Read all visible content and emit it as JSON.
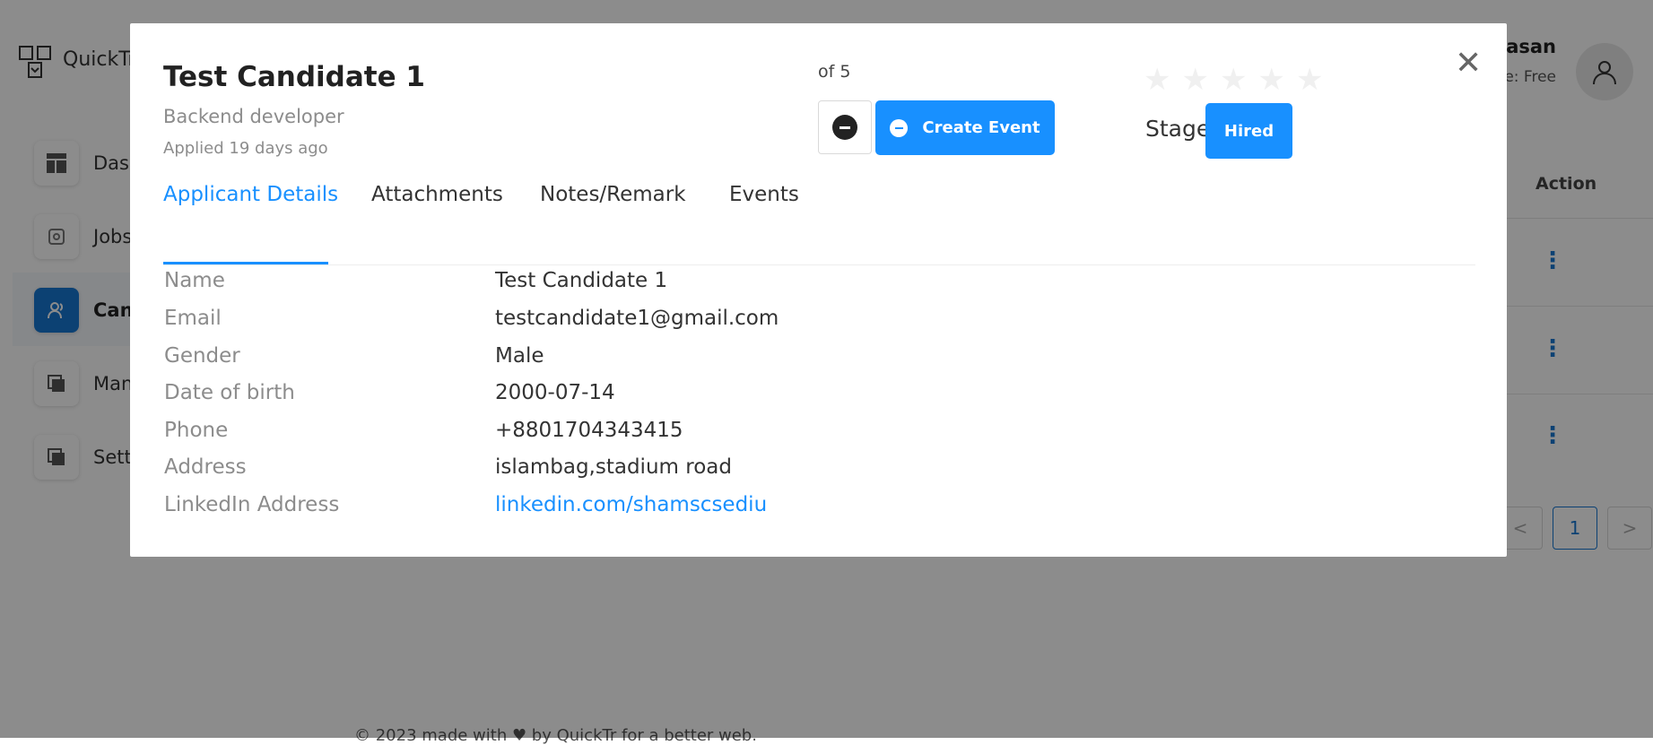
{
  "app": {
    "name": "QuickTr",
    "user_name": "Hasan",
    "user_plan": "e: Free"
  },
  "sidebar": {
    "items": [
      {
        "label": "Dash",
        "icon": "dashboard-icon"
      },
      {
        "label": "Jobs",
        "icon": "jobs-icon"
      },
      {
        "label": "Cand",
        "icon": "candidates-icon"
      },
      {
        "label": "Man",
        "icon": "copy-icon"
      },
      {
        "label": "Setti",
        "icon": "copy-icon"
      }
    ]
  },
  "table": {
    "action_header": "Action",
    "row_actions": [
      "⋮",
      "⋮",
      "⋮"
    ]
  },
  "pagination": {
    "prev": "<",
    "current": "1",
    "next": ">"
  },
  "footer": {
    "text": "© 2023 made with ♥ by QuickTr for a better web."
  },
  "modal": {
    "title": "Test Candidate 1",
    "role": "Backend developer",
    "applied": "Applied 19 days ago",
    "counter": "of 5",
    "create_event_label": "Create Event",
    "rating": 0,
    "rating_max": 5,
    "stage_label": "Stage",
    "stage_value": "Hired",
    "close_icon": "close-icon",
    "tabs": [
      {
        "label": "Applicant Details",
        "active": true
      },
      {
        "label": "Attachments",
        "active": false
      },
      {
        "label": "Notes/Remark",
        "active": false
      },
      {
        "label": "Events",
        "active": false
      }
    ],
    "details": [
      {
        "label": "Name",
        "value": "Test Candidate 1"
      },
      {
        "label": "Email",
        "value": "testcandidate1@gmail.com"
      },
      {
        "label": "Gender",
        "value": "Male"
      },
      {
        "label": "Date of birth",
        "value": "2000-07-14"
      },
      {
        "label": "Phone",
        "value": "+8801704343415"
      },
      {
        "label": "Address",
        "value": "islambag,stadium road"
      },
      {
        "label": "LinkedIn Address",
        "value": "linkedin.com/shamscsediu",
        "link": true
      }
    ]
  },
  "colors": {
    "accent": "#1890ff",
    "sidebar_active": "#1677d2",
    "overlay": "rgba(0,0,0,0.45)"
  }
}
